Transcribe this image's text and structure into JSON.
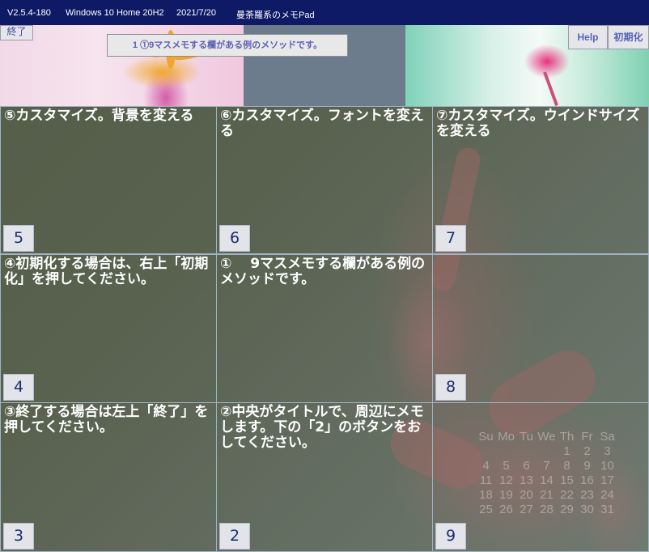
{
  "titlebar": {
    "version": "V2.5.4-180",
    "os": "Windows 10 Home 20H2",
    "date": "2021/7/20",
    "app_name": "曼荼羅系のメモPad"
  },
  "buttons": {
    "end": "終了",
    "help": "Help",
    "init": "初期化"
  },
  "title_box": "1 ①9マスメモする欄がある例のメソッドです。",
  "cells": [
    {
      "text": "⑤カスタマイズ。背景を変える",
      "number": "5"
    },
    {
      "text": "⑥カスタマイズ。フォントを変える",
      "number": "6"
    },
    {
      "text": "⑦カスタマイズ。ウインドサイズを変える",
      "number": "7"
    },
    {
      "text": "④初期化する場合は、右上「初期化」を押してください。",
      "number": "4"
    },
    {
      "text": "①　 9マスメモする欄がある例のメソッドです。",
      "number": ""
    },
    {
      "text": "",
      "number": "8"
    },
    {
      "text": "③終了する場合は左上「終了」を押してください。",
      "number": "3"
    },
    {
      "text": "②中央がタイトルで、周辺にメモします。下の「2」のボタンをおしてください。",
      "number": "2"
    },
    {
      "text": "",
      "number": "9"
    }
  ],
  "calendar": {
    "weekdays": [
      "Su",
      "Mo",
      "Tu",
      "We",
      "Th",
      "Fr",
      "Sa"
    ],
    "weeks": [
      [
        "",
        "",
        "",
        "",
        "1",
        "2",
        "3"
      ],
      [
        "4",
        "5",
        "6",
        "7",
        "8",
        "9",
        "10"
      ],
      [
        "11",
        "12",
        "13",
        "14",
        "15",
        "16",
        "17"
      ],
      [
        "18",
        "19",
        "20",
        "21",
        "22",
        "23",
        "24"
      ],
      [
        "25",
        "26",
        "27",
        "28",
        "29",
        "30",
        "31"
      ]
    ]
  }
}
